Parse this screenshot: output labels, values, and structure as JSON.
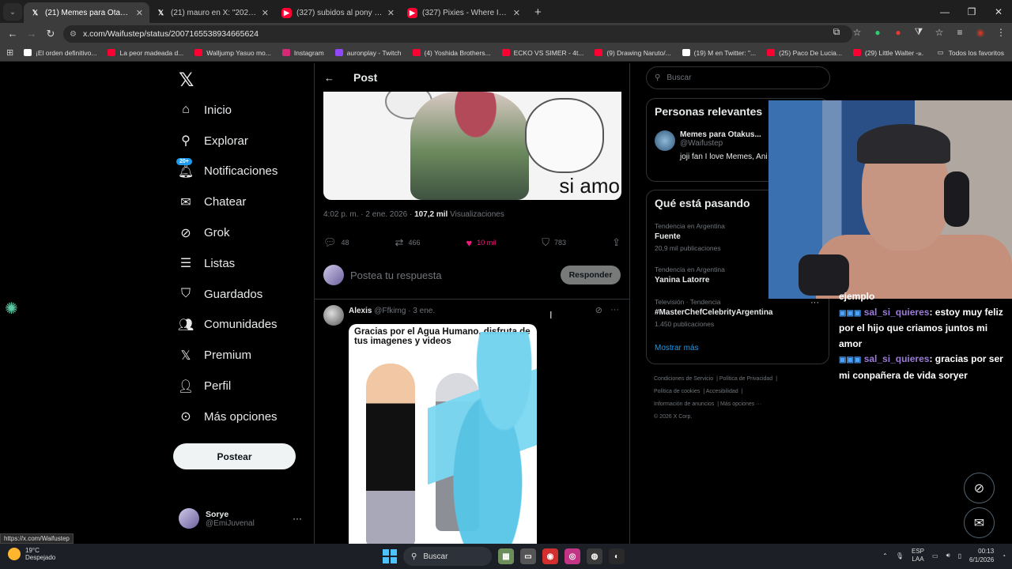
{
  "browser": {
    "tabs": [
      {
        "label": "(21) Memes para Otakus Gaymer",
        "icon": "x-logo",
        "active": true
      },
      {
        "label": "(21) mauro en X: \"2025: grok en",
        "icon": "x-logo",
        "active": false
      },
      {
        "label": "(327) subidos al pony - YouTube",
        "icon": "youtube-logo",
        "active": false
      },
      {
        "label": "(327) Pixies - Where Is My Mind",
        "icon": "youtube-logo",
        "active": false
      }
    ],
    "url": "x.com/Waifustep/status/2007165538934665624",
    "bookmarks": [
      {
        "label": "¡El orden definitivo...",
        "color": "#ffffff"
      },
      {
        "label": "La peor madeada d...",
        "color": "#ff0033"
      },
      {
        "label": "Walljump Yasuo mo...",
        "color": "#ff0033"
      },
      {
        "label": "Instagram",
        "color": "#d62976"
      },
      {
        "label": "auronplay - Twitch",
        "color": "#9146ff"
      },
      {
        "label": "(4) Yoshida Brothers...",
        "color": "#ff0033"
      },
      {
        "label": "ECKO VS SIMER - 4t...",
        "color": "#ff0033"
      },
      {
        "label": "(9) Drawing Naruto/...",
        "color": "#ff0033"
      },
      {
        "label": "(19) M en Twitter: \"...",
        "color": "#ffffff"
      },
      {
        "label": "(25) Paco De Lucia...",
        "color": "#ff0033"
      },
      {
        "label": "(29) Little Walter -...",
        "color": "#ff0033"
      }
    ],
    "all_bookmarks": "Todos los favoritos"
  },
  "sidebar": {
    "items": [
      {
        "label": "Inicio",
        "icon": "home-icon"
      },
      {
        "label": "Explorar",
        "icon": "search-icon"
      },
      {
        "label": "Notificaciones",
        "icon": "bell-icon",
        "badge": "20+"
      },
      {
        "label": "Chatear",
        "icon": "mail-icon"
      },
      {
        "label": "Grok",
        "icon": "grok-icon"
      },
      {
        "label": "Listas",
        "icon": "list-icon"
      },
      {
        "label": "Guardados",
        "icon": "bookmark-icon"
      },
      {
        "label": "Comunidades",
        "icon": "communities-icon"
      },
      {
        "label": "Premium",
        "icon": "x-icon"
      },
      {
        "label": "Perfil",
        "icon": "person-icon"
      },
      {
        "label": "Más opciones",
        "icon": "more-circle-icon"
      }
    ],
    "post_button": "Postear",
    "user": {
      "name": "Sorye",
      "handle": "@EmiJuvenal"
    }
  },
  "post": {
    "header": "Post",
    "meme_text": "si amo",
    "time": "4:02 p. m. · 2 ene. 2026 · ",
    "views_count": "107,2 mil",
    "views_label": " Visualizaciones",
    "replies": "48",
    "reposts": "466",
    "likes": "10 mil",
    "bookmarks": "783",
    "reply_placeholder": "Postea tu respuesta",
    "reply_button": "Responder"
  },
  "comment": {
    "name": "Alexis",
    "handle": "@Ffkimg",
    "date": "· 3 ene.",
    "image_caption": "Gracias por el Agua Humano, disfruta de tus imagenes y videos"
  },
  "right": {
    "search_placeholder": "Buscar",
    "relevant_title": "Personas relevantes",
    "relevant_user": {
      "name": "Memes para Otakus...",
      "handle": "@Waifustep",
      "bio": "joji fan I love Memes, Ani ill girls"
    },
    "trending_title": "Qué está pasando",
    "trends": [
      {
        "category": "Tendencia en Argentina",
        "name": "Fuente",
        "count": "20,9 mil publicaciones"
      },
      {
        "category": "Tendencia en Argentina",
        "name": "Yanina Latorre",
        "count": ""
      },
      {
        "category": "Televisión · Tendencia",
        "name": "#MasterChefCelebrityArgentina",
        "count": "1.450 publicaciones"
      }
    ],
    "show_more": "Mostrar más",
    "footer": [
      "Condiciones de Servicio",
      "Política de Privacidad",
      "Política de cookies",
      "Accesibilidad",
      "Información de anuncios",
      "Más opciones ···",
      "© 2026 X Corp."
    ]
  },
  "chat": {
    "partial": "ejemplo",
    "messages": [
      {
        "user": "sal_si_quieres",
        "text": ": estoy muy feliz por el hijo que criamos juntos mi amor"
      },
      {
        "user": "sal_si_quieres",
        "text": ": gracias por ser mi conpañera de vida soryer"
      }
    ]
  },
  "status_link": "https://x.com/Waifustep",
  "taskbar": {
    "temp": "19°C",
    "weather": "Despejado",
    "search": "Buscar",
    "lang1": "ESP",
    "lang2": "LAA",
    "time": "00:13",
    "date": "6/1/2026"
  }
}
